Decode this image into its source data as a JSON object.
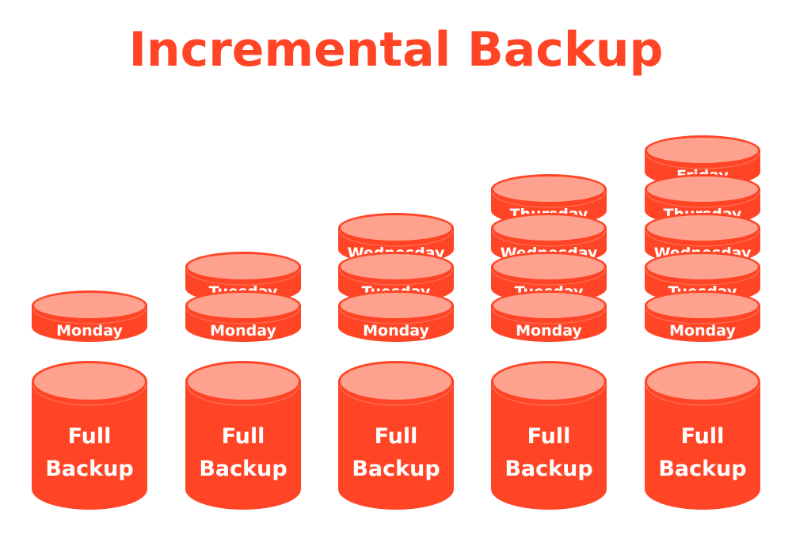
{
  "title": "Incremental Backup",
  "colors": {
    "body": "#ff4526",
    "top": "#ffa18f",
    "text": "#ffffff",
    "background": "#ffffff"
  },
  "full_backup_label": [
    "Full",
    "Backup"
  ],
  "columns": [
    {
      "full_backup": [
        "Full",
        "Backup"
      ],
      "increments": [
        "Monday"
      ]
    },
    {
      "full_backup": [
        "Full",
        "Backup"
      ],
      "increments": [
        "Monday",
        "Tuesday"
      ]
    },
    {
      "full_backup": [
        "Full",
        "Backup"
      ],
      "increments": [
        "Monday",
        "Tuesday",
        "Wednesday"
      ]
    },
    {
      "full_backup": [
        "Full",
        "Backup"
      ],
      "increments": [
        "Monday",
        "Tuesday",
        "Wednesday",
        "Thursday"
      ]
    },
    {
      "full_backup": [
        "Full",
        "Backup"
      ],
      "increments": [
        "Monday",
        "Tuesday",
        "Wednesday",
        "Thursday",
        "Friday"
      ]
    }
  ]
}
